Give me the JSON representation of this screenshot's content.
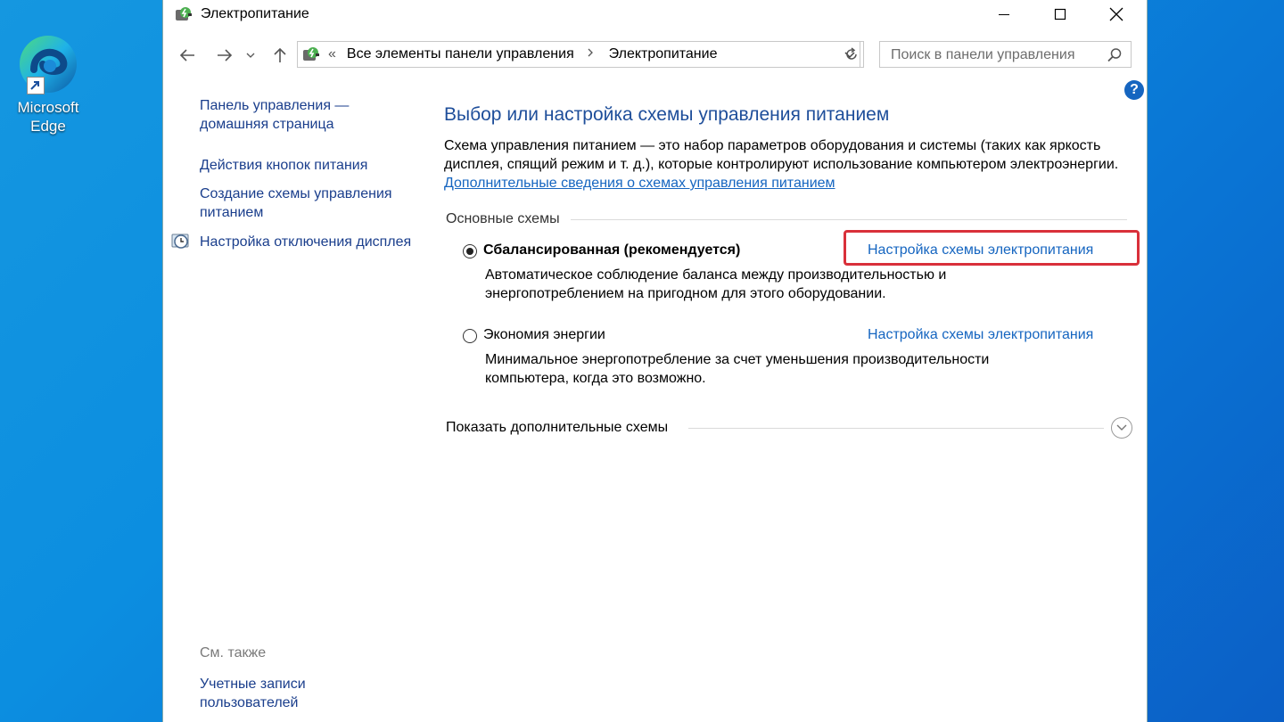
{
  "desktop": {
    "icons": [
      {
        "label": "Microsoft Edge",
        "icon": "edge-icon"
      }
    ]
  },
  "window": {
    "title": "Электропитание",
    "icon": "power-options-icon",
    "controls": {
      "minimize": "minimize-icon",
      "maximize": "maximize-icon",
      "close": "close-icon"
    }
  },
  "navigation": {
    "back": "back-arrow-icon",
    "forward": "forward-arrow-icon",
    "up": "up-arrow-icon",
    "address": {
      "overflow": "«",
      "crumbs": [
        "Все элементы панели управления",
        "Электропитание"
      ]
    },
    "search_placeholder": "Поиск в панели управления"
  },
  "left_pane": {
    "links": [
      "Панель управления — домашняя страница",
      "Действия кнопок питания",
      "Создание схемы управления питанием",
      "Настройка отключения дисплея"
    ],
    "see_also_title": "См. также",
    "see_also_links": [
      "Учетные записи пользователей"
    ]
  },
  "main": {
    "heading": "Выбор или настройка схемы управления питанием",
    "description": "Схема управления питанием — это набор параметров оборудования и системы (таких как яркость дисплея, спящий режим и т. д.), которые контролируют использование компьютером электроэнергии.",
    "description_link": "Дополнительные сведения о схемах управления питанием",
    "section_title": "Основные схемы",
    "plans": [
      {
        "name": "Сбалансированная (рекомендуется)",
        "selected": true,
        "description": "Автоматическое соблюдение баланса между производительностью и энергопотреблением на пригодном для этого оборудовании.",
        "configure_link": "Настройка схемы электропитания"
      },
      {
        "name": "Экономия энергии",
        "selected": false,
        "description": "Минимальное энергопотребление за счет уменьшения производительности компьютера, когда это возможно.",
        "configure_link": "Настройка схемы электропитания"
      }
    ],
    "show_more": "Показать дополнительные схемы"
  },
  "colors": {
    "link": "#1565c0",
    "heading": "#1e4e9a",
    "highlight": "#d9303a",
    "desktop": "#0c8ee0"
  }
}
